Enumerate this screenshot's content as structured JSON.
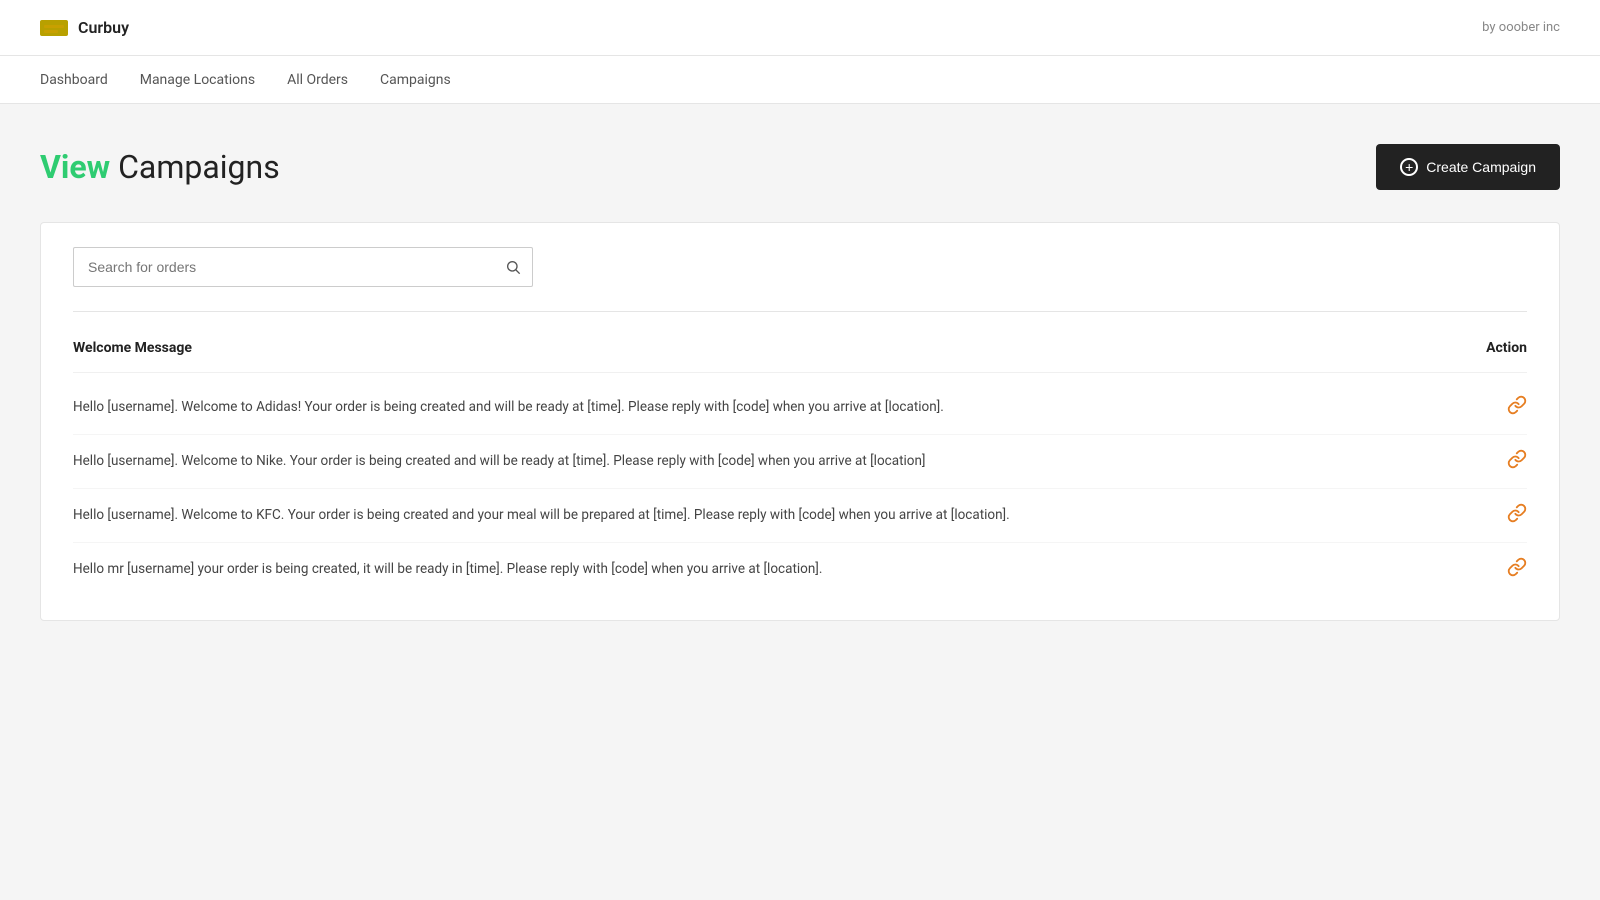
{
  "app": {
    "logo_text": "Curbuy",
    "top_right": "by ooober inc"
  },
  "nav": {
    "items": [
      {
        "label": "Dashboard",
        "id": "dashboard"
      },
      {
        "label": "Manage Locations",
        "id": "manage-locations"
      },
      {
        "label": "All Orders",
        "id": "all-orders"
      },
      {
        "label": "Campaigns",
        "id": "campaigns"
      }
    ]
  },
  "page": {
    "title_highlight": "View",
    "title_rest": " Campaigns",
    "create_btn": "Create Campaign"
  },
  "search": {
    "placeholder": "Search for orders"
  },
  "table": {
    "col_message": "Welcome Message",
    "col_action": "Action",
    "rows": [
      {
        "message": "Hello [username]. Welcome to Adidas! Your order is being created and will be ready at [time]. Please reply with [code] when you arrive at [location]."
      },
      {
        "message": "Hello [username]. Welcome to Nike. Your order is being created and will be ready at [time]. Please reply with [code] when you arrive at [location]"
      },
      {
        "message": "Hello [username]. Welcome to KFC. Your order is being created and your meal will be prepared at [time]. Please reply with [code] when you arrive at [location]."
      },
      {
        "message": "Hello mr [username] your order is being created, it will be ready in [time]. Please reply with [code] when you arrive at [location]."
      }
    ]
  },
  "icons": {
    "link": "🔗",
    "plus": "+"
  }
}
